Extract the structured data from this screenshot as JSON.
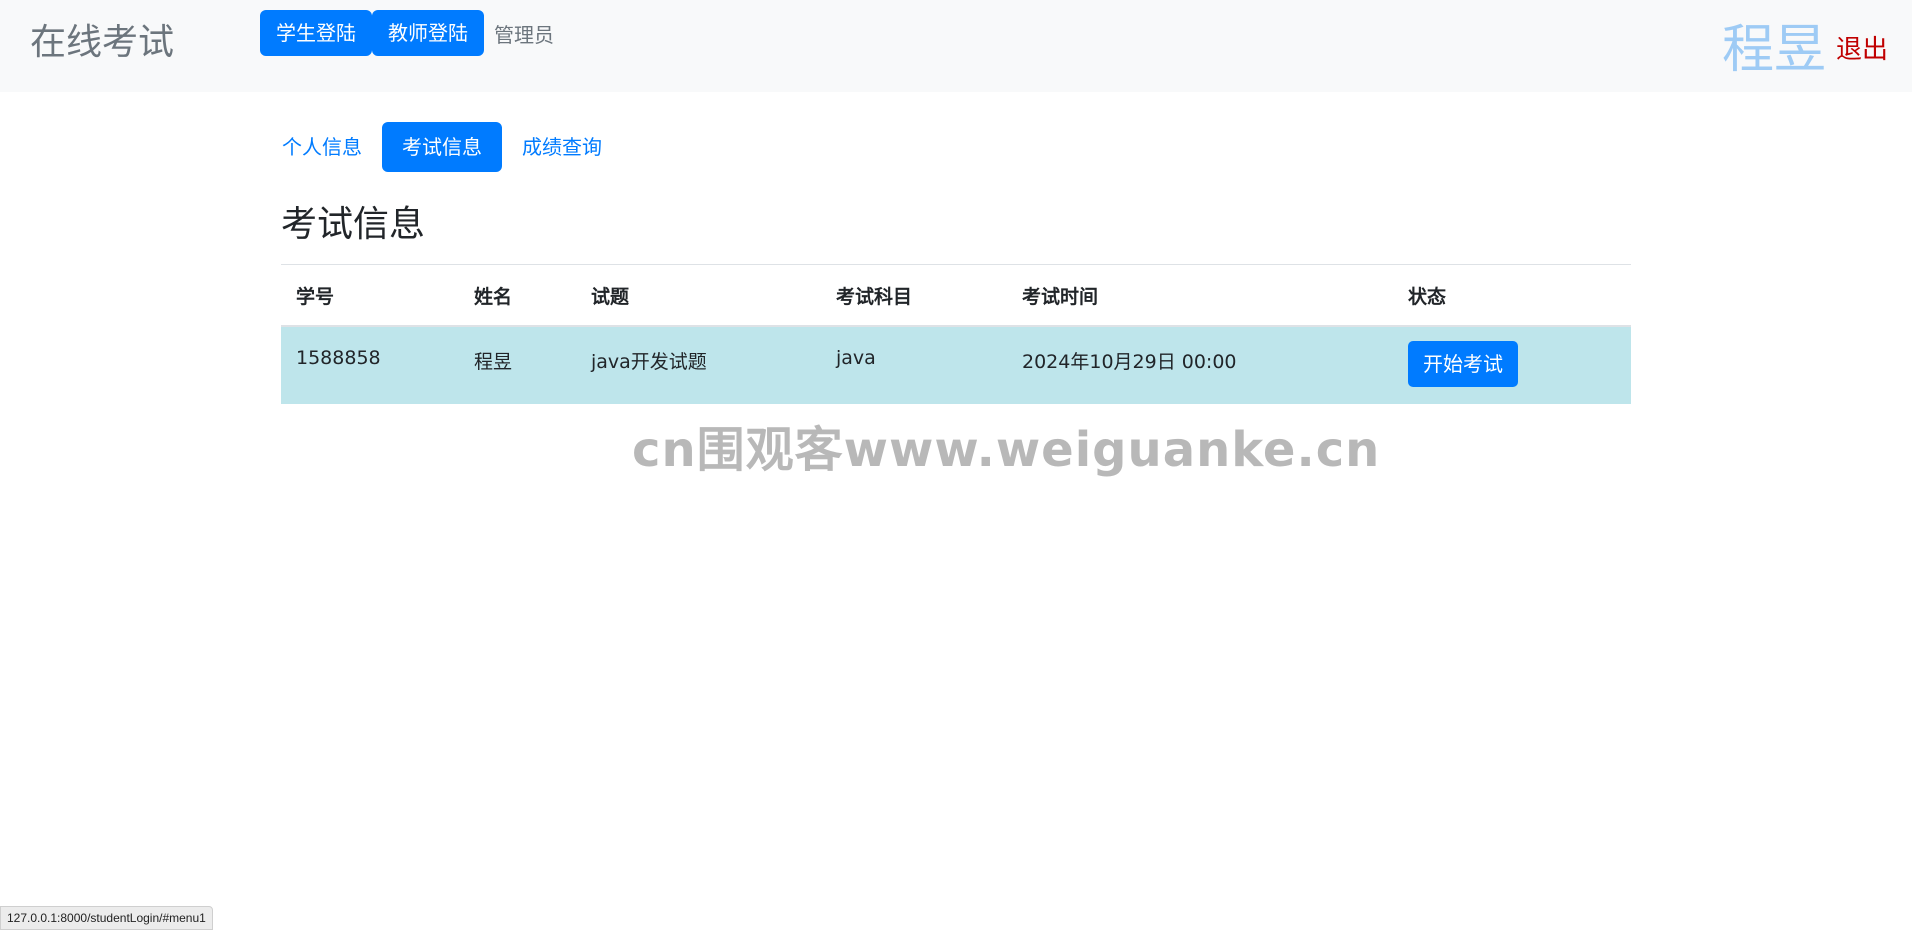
{
  "navbar": {
    "brand": "在线考试",
    "student_login": "学生登陆",
    "teacher_login": "教师登陆",
    "admin": "管理员",
    "user_name": "程昱",
    "logout": "退出"
  },
  "tabs": [
    {
      "label": "个人信息",
      "active": false
    },
    {
      "label": "考试信息",
      "active": true
    },
    {
      "label": "成绩查询",
      "active": false
    }
  ],
  "section_title": "考试信息",
  "table": {
    "headers": [
      "学号",
      "姓名",
      "试题",
      "考试科目",
      "考试时间",
      "状态"
    ],
    "rows": [
      {
        "student_id": "1588858",
        "name": "程昱",
        "paper": "java开发试题",
        "subject": "java",
        "time": "2024年10月29日 00:00",
        "action": "开始考试"
      }
    ]
  },
  "watermark": "cn围观客www.weiguanke.cn",
  "status_url": "127.0.0.1:8000/studentLogin/#menu1",
  "colors": {
    "primary": "#007bff",
    "navbar_bg": "#f8f9fa",
    "row_info": "#bee5eb",
    "logout": "#c00000"
  }
}
